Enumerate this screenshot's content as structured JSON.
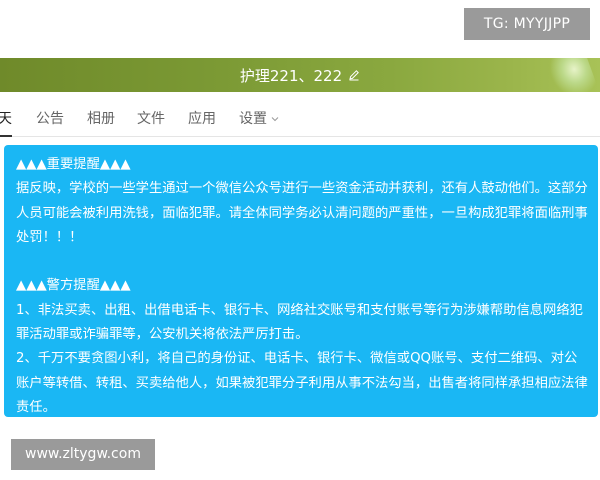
{
  "watermark_top": "TG: MYYJJPP",
  "header": {
    "title": "护理221、222",
    "edit_icon": "pencil-icon",
    "background_color": "#7b9934"
  },
  "tabs": [
    {
      "label": "天",
      "active": true
    },
    {
      "label": "公告",
      "active": false
    },
    {
      "label": "相册",
      "active": false
    },
    {
      "label": "文件",
      "active": false
    },
    {
      "label": "应用",
      "active": false
    },
    {
      "label": "设置",
      "active": false,
      "icon": "chevron-down-icon"
    }
  ],
  "notice": {
    "background_color": "#1ab7f4",
    "section1_title": "▲▲▲重要提醒▲▲▲",
    "section1_body": "据反映，学校的一些学生通过一个微信公众号进行一些资金活动并获利，还有人鼓动他们。这部分人员可能会被利用洗钱，面临犯罪。请全体同学务必认清问题的严重性，一旦构成犯罪将面临刑事处罚！！！",
    "section2_title": "▲▲▲警方提醒▲▲▲",
    "section2_item1": "1、非法买卖、出租、出借电话卡、银行卡、网络社交账号和支付账号等行为涉嫌帮助信息网络犯罪活动罪或诈骗罪等，公安机关将依法严厉打击。",
    "section2_item2": "2、千万不要贪图小利，将自己的身份证、电话卡、银行卡、微信或QQ账号、支付二维码、对公账户等转借、转租、买卖给他人，如果被犯罪分子利用从事不法勾当，出售者将同样承担相应法律责任。"
  },
  "watermark_bottom": "www.zltygw.com"
}
